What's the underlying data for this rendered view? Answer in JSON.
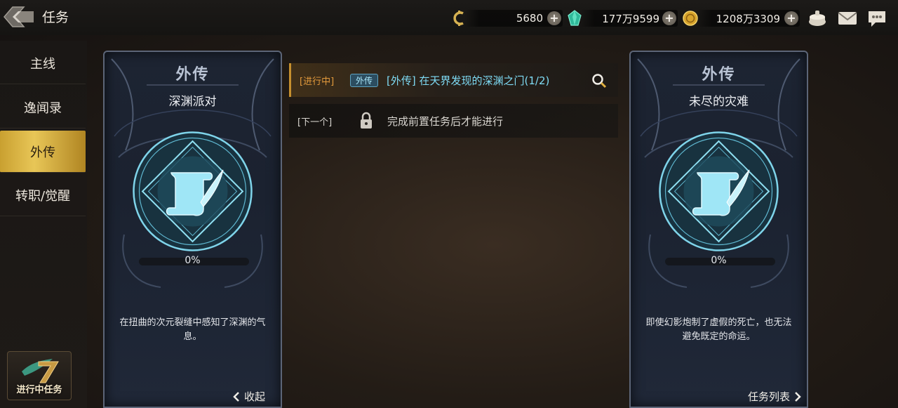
{
  "header": {
    "title": "任务",
    "currencies": [
      {
        "icon": "gold-c-coin-icon",
        "value": "5680"
      },
      {
        "icon": "green-crystal-icon",
        "value": "177万9599"
      },
      {
        "icon": "gold-coin-icon",
        "value": "1208万3309"
      }
    ],
    "icons": [
      "treasure-pot-icon",
      "mail-icon",
      "chat-icon"
    ]
  },
  "sidebar": {
    "items": [
      {
        "label": "主线",
        "active": false
      },
      {
        "label": "逸闻录",
        "active": false
      },
      {
        "label": "外传",
        "active": true
      },
      {
        "label": "转职/觉醒",
        "active": false
      }
    ],
    "progress_task_label": "进行中任务"
  },
  "cards": [
    {
      "heading": "外传",
      "name": "深渊派对",
      "progress": 0,
      "progress_text": "0%",
      "description": "在扭曲的次元裂缝中感知了深渊的气息。",
      "footer": "收起"
    },
    {
      "heading": "外传",
      "name": "未尽的灾难",
      "progress": 0,
      "progress_text": "0%",
      "description": "即使幻影炮制了虚假的死亡，也无法避免既定的命运。",
      "footer": "任务列表"
    }
  ],
  "quests": [
    {
      "status": "[进行中]",
      "badge": "外传",
      "text": "[外传] 在天界发现的深渊之门(1/2)"
    },
    {
      "status": "[下一个]",
      "text": "完成前置任务后才能进行"
    }
  ],
  "colors": {
    "accent_gold": "#e8c657",
    "quest_cyan": "#7fdcf6",
    "status_orange": "#e39a3c",
    "progress_cyan": "#6fd4ec"
  }
}
